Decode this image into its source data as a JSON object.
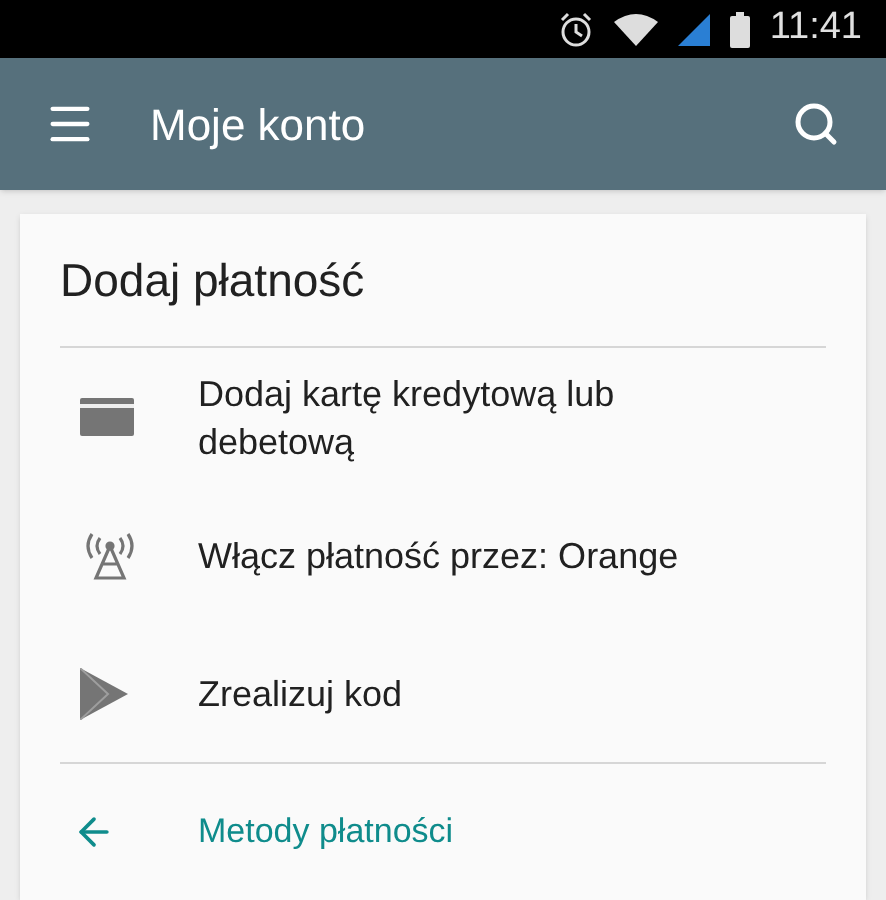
{
  "status_bar": {
    "time": "11:41"
  },
  "app_bar": {
    "title": "Moje konto"
  },
  "card": {
    "title": "Dodaj płatność",
    "options": [
      {
        "kind": "card",
        "label": "Dodaj kartę kredytową lub debetową"
      },
      {
        "kind": "carrier",
        "label": "Włącz płatność przez: Orange"
      },
      {
        "kind": "play",
        "label": "Zrealizuj kod"
      }
    ],
    "footer_link": {
      "label": "Metody płatności"
    }
  }
}
